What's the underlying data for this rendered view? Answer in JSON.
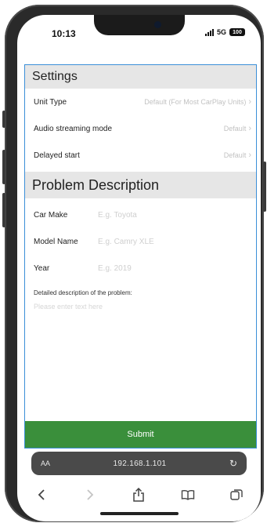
{
  "status": {
    "time": "10:13",
    "network": "5G",
    "battery": "100"
  },
  "settings": {
    "title": "Settings",
    "rows": [
      {
        "label": "Unit Type",
        "value": "Default (For Most CarPlay Units)"
      },
      {
        "label": "Audio streaming mode",
        "value": "Default"
      },
      {
        "label": "Delayed start",
        "value": "Default"
      }
    ]
  },
  "problem": {
    "title": "Problem Description",
    "car_make": {
      "label": "Car Make",
      "placeholder": "E.g. Toyota"
    },
    "model_name": {
      "label": "Model Name",
      "placeholder": "E.g. Camry XLE"
    },
    "year": {
      "label": "Year",
      "placeholder": "E.g. 2019"
    },
    "description": {
      "label": "Detailed description of the problem:",
      "placeholder": "Please enter text here"
    }
  },
  "submit_label": "Submit",
  "browser": {
    "text_size": "AA",
    "url": "192.168.1.101"
  },
  "toolbar_icons": [
    "back-icon",
    "forward-icon",
    "share-icon",
    "bookmarks-icon",
    "tabs-icon"
  ],
  "colors": {
    "accent_border": "#3b8fd8",
    "submit_bg": "#3a8f3b",
    "header_bg": "#e6e6e6"
  }
}
